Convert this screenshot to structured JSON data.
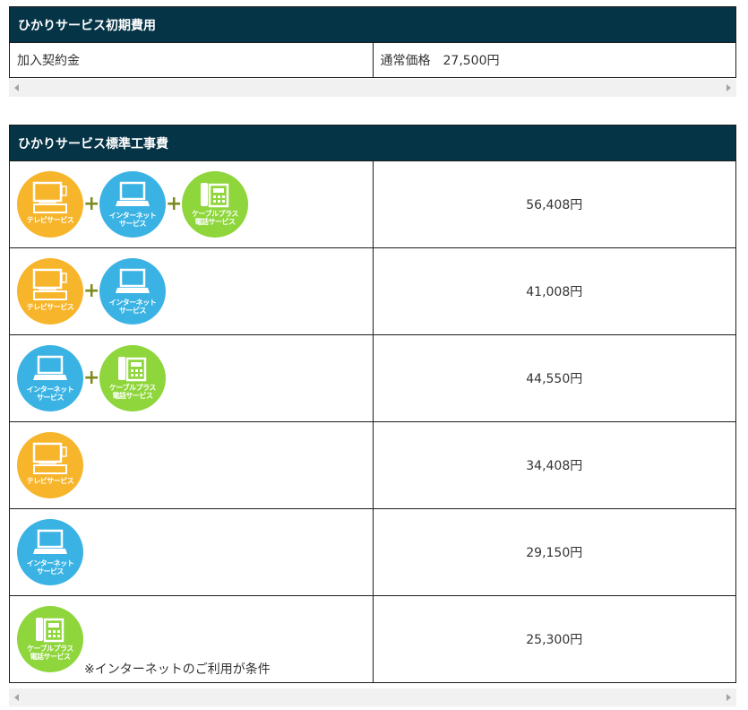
{
  "initial_fee": {
    "title": "ひかりサービス初期費用",
    "item": "加入契約金",
    "value": "通常価格　27,500円"
  },
  "standard_construction": {
    "title": "ひかりサービス標準工事費",
    "icon_labels": {
      "tv": [
        "テレビサービス"
      ],
      "net": [
        "インターネット",
        "サービス"
      ],
      "tel": [
        "ケーブルプラス",
        "電話サービス"
      ]
    },
    "plus": "+",
    "rows": [
      {
        "price": "56,408円"
      },
      {
        "price": "41,008円"
      },
      {
        "price": "44,550円"
      },
      {
        "price": "34,408円"
      },
      {
        "price": "29,150円"
      },
      {
        "price": "25,300円",
        "note": "※インターネットのご利用が条件"
      }
    ]
  },
  "colors": {
    "header_bg": "#063447",
    "tv": "#f7b52b",
    "net": "#3ab3e4",
    "tel": "#8ed63b",
    "plus": "#7e8a1d"
  }
}
